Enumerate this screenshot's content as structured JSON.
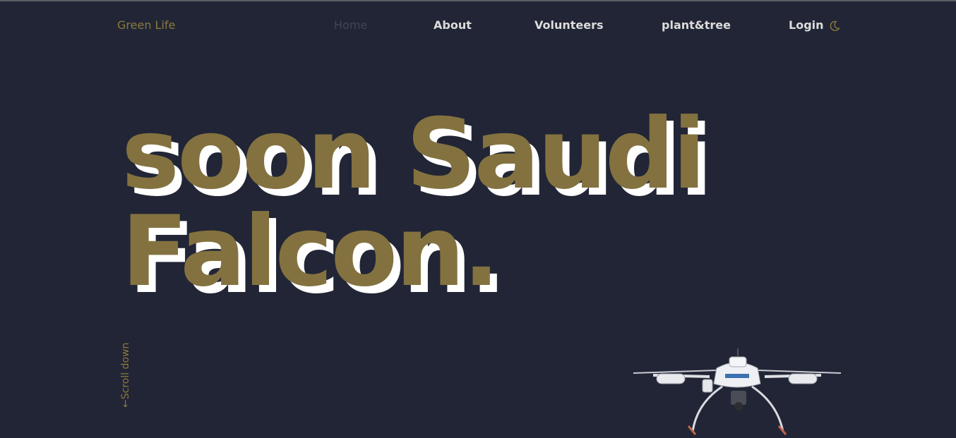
{
  "nav": {
    "brand": "Green Life",
    "items": [
      {
        "label": "Home",
        "active": true
      },
      {
        "label": "About",
        "active": false
      },
      {
        "label": "Volunteers",
        "active": false
      },
      {
        "label": "plant&tree",
        "active": false
      },
      {
        "label": "Login",
        "active": false
      }
    ],
    "theme_toggle_icon": "moon-icon"
  },
  "hero": {
    "line1": "soon Saudi",
    "line2": "Falcon."
  },
  "scroll": {
    "label": "←Scroll down"
  },
  "image": {
    "icon": "drone-image"
  },
  "colors": {
    "background": "#222535",
    "accent": "#837240",
    "nav_text": "#dcdcdc",
    "active_nav": "#3e4656"
  }
}
